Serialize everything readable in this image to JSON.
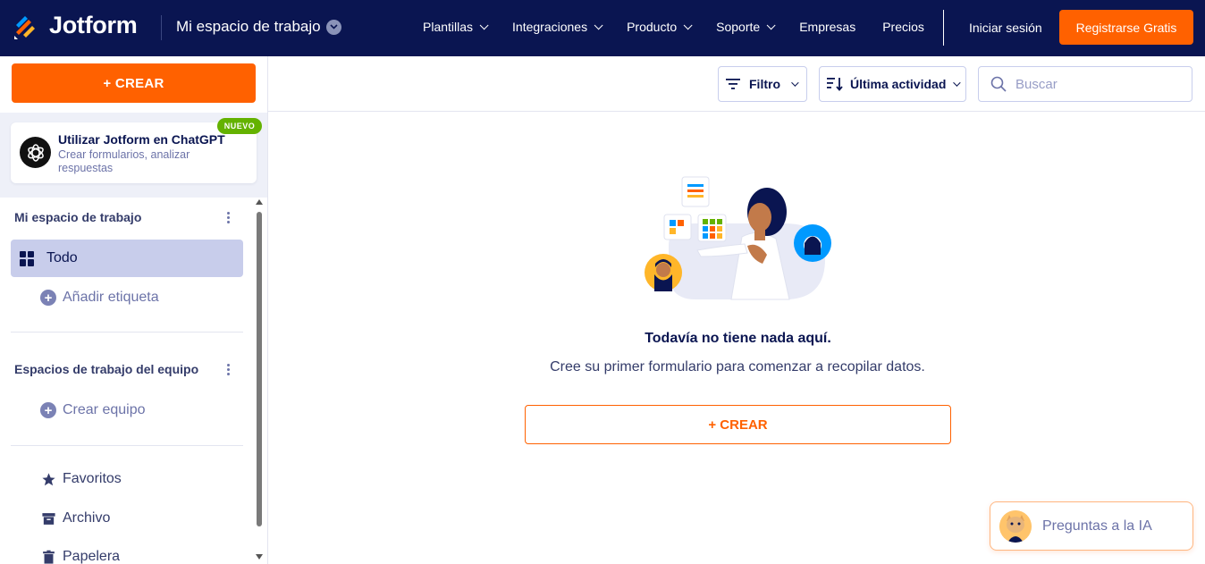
{
  "header": {
    "brand": "Jotform",
    "workspace": "Mi espacio de trabajo",
    "nav": [
      {
        "label": "Plantillas",
        "dropdown": true
      },
      {
        "label": "Integraciones",
        "dropdown": true
      },
      {
        "label": "Producto",
        "dropdown": true
      },
      {
        "label": "Soporte",
        "dropdown": true
      },
      {
        "label": "Empresas",
        "dropdown": false
      },
      {
        "label": "Precios",
        "dropdown": false
      }
    ],
    "login": "Iniciar sesión",
    "register": "Registrarse Gratis"
  },
  "sidebar": {
    "create": "+ CREAR",
    "chatgpt": {
      "title": "Utilizar Jotform en ChatGPT",
      "subtitle": "Crear formularios, analizar respuestas",
      "badge": "NUEVO"
    },
    "my_workspace": "Mi espacio de trabajo",
    "all": "Todo",
    "add_tag": "Añadir etiqueta",
    "team_workspaces": "Espacios de trabajo del equipo",
    "create_team": "Crear equipo",
    "favorites": "Favoritos",
    "archive": "Archivo",
    "trash": "Papelera"
  },
  "toolbar": {
    "filter": "Filtro",
    "sort": "Última actividad",
    "search_placeholder": "Buscar"
  },
  "empty_state": {
    "title": "Todavía no tiene nada aquí.",
    "subtitle": "Cree su primer formulario para comenzar a recopilar datos.",
    "create": "+ CREAR"
  },
  "ai": {
    "label": "Preguntas a la IA"
  },
  "colors": {
    "navy": "#0a1551",
    "orange": "#ff6100",
    "green": "#64b200"
  }
}
